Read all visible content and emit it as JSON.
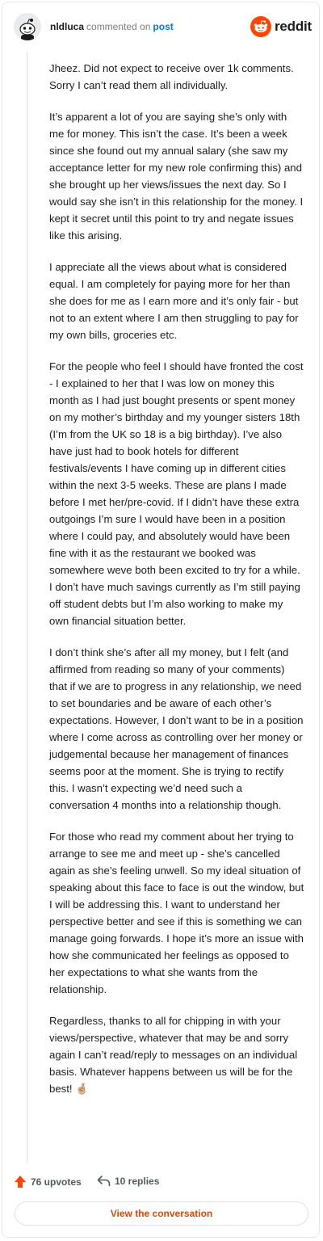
{
  "header": {
    "username": "nldluca",
    "verb": "commented on",
    "post_link": "post",
    "brand_name": "reddit"
  },
  "comment": {
    "paragraphs": [
      "Jheez. Did not expect to receive over 1k comments. Sorry I can’t read them all individually.",
      "It’s apparent a lot of you are saying she’s only with me for money. This isn’t the case. It’s been a week since she found out my annual salary (she saw my acceptance letter for my new role confirming this) and she brought up her views/issues the next day. So I would say she isn’t in this relationship for the money. I kept it secret until this point to try and negate issues like this arising.",
      "I appreciate all the views about what is considered equal. I am completely for paying more for her than she does for me as I earn more and it’s only fair - but not to an extent where I am then struggling to pay for my own bills, groceries etc.",
      "For the people who feel I should have fronted the cost - I explained to her that I was low on money this month as I had just bought presents or spent money on my mother’s birthday and my younger sisters 18th (I’m from the UK so 18 is a big birthday). I’ve also have just had to book hotels for different festivals/events I have coming up in different cities within the next 3-5 weeks. These are plans I made before I met her/pre-covid. If I didn’t have these extra outgoings I’m sure I would have been in a position where I could pay, and absolutely would have been fine with it as the restaurant we booked was somewhere weve both been excited to try for a while. I don’t have much savings currently as I’m still paying off student debts but I’m also working to make my own financial situation better.",
      "I don’t think she’s after all my money, but I felt (and affirmed from reading so many of your comments) that if we are to progress in any relationship, we need to set boundaries and be aware of each other’s expectations. However, I don’t want to be in a position where I come across as controlling over her money or judgemental because her management of finances seems poor at the moment. She is trying to rectify this. I wasn’t expecting we’d need such a conversation 4 months into a relationship though.",
      "For those who read my comment about her trying to arrange to see me and meet up - she’s cancelled again as she’s feeling unwell. So my ideal situation of speaking about this face to face is out the window, but I will be addressing this. I want to understand her perspective better and see if this is something we can manage going forwards. I hope it’s more an issue with how she communicated her feelings as opposed to her expectations to what she wants from the relationship.",
      "Regardless, thanks to all for chipping in with your views/perspective, whatever that may be and sorry again I can’t read/reply to messages on an individual basis. Whatever happens between us will be for the best! 🤞🏼"
    ]
  },
  "footer": {
    "upvotes_label": "76 upvotes",
    "replies_label": "10 replies",
    "view_button": "View the conversation"
  },
  "colors": {
    "reddit_orange": "#ff4500",
    "link_blue": "#0079d3",
    "button_text": "#d84a0c"
  },
  "icons": {
    "avatar": "snoo-avatar-icon",
    "logo": "reddit-logo-icon",
    "upvote": "upvote-arrow-icon",
    "reply": "reply-arrow-icon"
  }
}
